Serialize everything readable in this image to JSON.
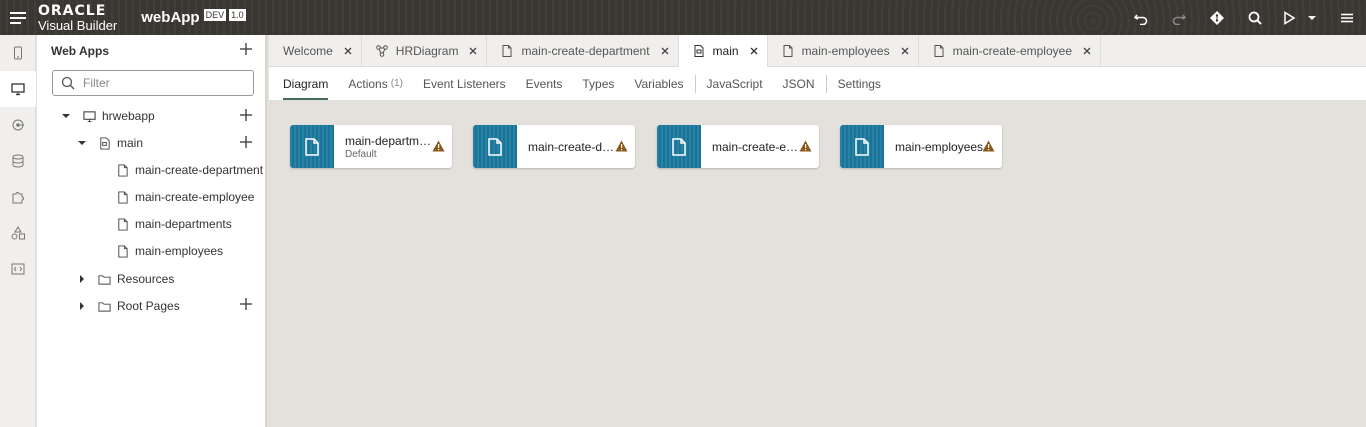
{
  "header": {
    "brand_top": "ORACLE",
    "brand_bottom": "Visual Builder",
    "app_name": "webApp",
    "env_badge": "DEV",
    "version_badge": "1.0"
  },
  "navigator": {
    "title": "Web Apps",
    "filter_placeholder": "Filter",
    "tree": {
      "root": "hrwebapp",
      "main": "main",
      "pages": [
        "main-create-department",
        "main-create-employee",
        "main-departments",
        "main-employees"
      ],
      "resources": "Resources",
      "root_pages": "Root Pages"
    }
  },
  "tabs": [
    {
      "label": "Welcome",
      "icon": "none"
    },
    {
      "label": "HRDiagram",
      "icon": "diagram-icon"
    },
    {
      "label": "main-create-department",
      "icon": "page-icon"
    },
    {
      "label": "main",
      "icon": "flow-icon"
    },
    {
      "label": "main-employees",
      "icon": "page-icon"
    },
    {
      "label": "main-create-employee",
      "icon": "page-icon"
    }
  ],
  "subtabs": {
    "diagram": "Diagram",
    "actions": "Actions",
    "actions_count": "(1)",
    "event_listeners": "Event Listeners",
    "events": "Events",
    "types": "Types",
    "variables": "Variables",
    "javascript": "JavaScript",
    "json": "JSON",
    "settings": "Settings"
  },
  "diagram": {
    "cards": [
      {
        "name": "main-departments",
        "subtitle": "Default"
      },
      {
        "name": "main-create-department",
        "subtitle": ""
      },
      {
        "name": "main-create-employee",
        "subtitle": ""
      },
      {
        "name": "main-employees",
        "subtitle": ""
      }
    ]
  },
  "colors": {
    "header_bg": "#3a3632",
    "card_icon_bg": "#1b7aa0",
    "warning": "#8a5a1c",
    "active_underline": "#4a6b56"
  }
}
